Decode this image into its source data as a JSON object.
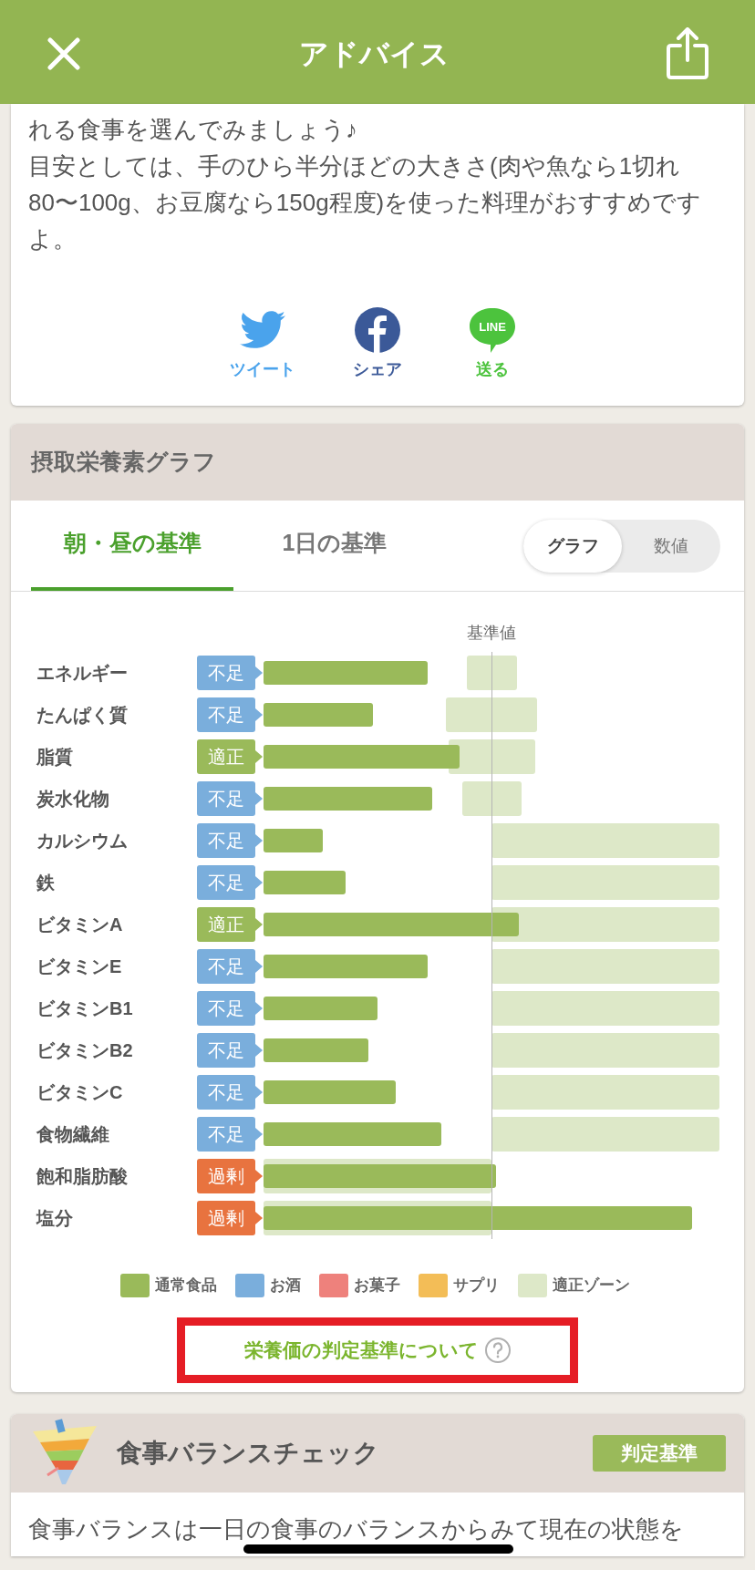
{
  "header": {
    "title": "アドバイス"
  },
  "advice": {
    "lines": [
      "れる食事を選んでみましょう♪",
      "目安としては、手のひら半分ほどの大きさ(肉や魚なら1切れ80〜100g、お豆腐なら150g程度)を使った料理がおすすめですよ。"
    ]
  },
  "share": [
    {
      "kind": "twitter",
      "label": "ツイート"
    },
    {
      "kind": "facebook",
      "label": "シェア"
    },
    {
      "kind": "line",
      "label": "送る",
      "logo_text": "LINE"
    }
  ],
  "nutrient_graph": {
    "title": "摂取栄養素グラフ",
    "tabs": [
      {
        "label": "朝・昼の基準",
        "selected": true
      },
      {
        "label": "1日の基準",
        "selected": false
      }
    ],
    "toggle": [
      {
        "label": "グラフ",
        "selected": true
      },
      {
        "label": "数値",
        "selected": false
      }
    ],
    "baseline_label": "基準値",
    "rows": [
      {
        "name": "エネルギー",
        "kind": "low",
        "badge": "不足",
        "zone": {
          "kind": "band"
        }
      },
      {
        "name": "たんぱく質",
        "kind": "low",
        "badge": "不足",
        "zone": {
          "kind": "band"
        }
      },
      {
        "name": "脂質",
        "kind": "ok",
        "badge": "適正",
        "zone": {
          "kind": "band"
        }
      },
      {
        "name": "炭水化物",
        "kind": "low",
        "badge": "不足",
        "zone": {
          "kind": "band"
        }
      },
      {
        "name": "カルシウム",
        "kind": "low",
        "badge": "不足",
        "zone": {
          "kind": "above"
        }
      },
      {
        "name": "鉄",
        "kind": "low",
        "badge": "不足",
        "zone": {
          "kind": "above"
        }
      },
      {
        "name": "ビタミンA",
        "kind": "ok",
        "badge": "適正",
        "zone": {
          "kind": "above"
        }
      },
      {
        "name": "ビタミンE",
        "kind": "low",
        "badge": "不足",
        "zone": {
          "kind": "above"
        }
      },
      {
        "name": "ビタミンB1",
        "kind": "low",
        "badge": "不足",
        "zone": {
          "kind": "above"
        }
      },
      {
        "name": "ビタミンB2",
        "kind": "low",
        "badge": "不足",
        "zone": {
          "kind": "above"
        }
      },
      {
        "name": "ビタミンC",
        "kind": "low",
        "badge": "不足",
        "zone": {
          "kind": "above"
        }
      },
      {
        "name": "食物繊維",
        "kind": "low",
        "badge": "不足",
        "zone": {
          "kind": "above"
        }
      },
      {
        "name": "飽和脂肪酸",
        "kind": "high",
        "badge": "過剰",
        "zone": {
          "kind": "below"
        }
      },
      {
        "name": "塩分",
        "kind": "high",
        "badge": "過剰",
        "zone": {
          "kind": "below"
        }
      }
    ],
    "legend": [
      {
        "label": "通常食品",
        "color": "#9aba5a"
      },
      {
        "label": "お酒",
        "color": "#7aaedc"
      },
      {
        "label": "お菓子",
        "color": "#ee817c"
      },
      {
        "label": "サプリ",
        "color": "#f3bd57"
      },
      {
        "label": "適正ゾーン",
        "color": "#dde8c8"
      }
    ],
    "criteria_link": {
      "label": "栄養価の判定基準について",
      "highlighted": true
    }
  },
  "balance_check": {
    "title": "食事バランスチェック",
    "button": "判定基準",
    "text": "食事バランスは一日の食事のバランスからみて現在の状態を"
  }
}
